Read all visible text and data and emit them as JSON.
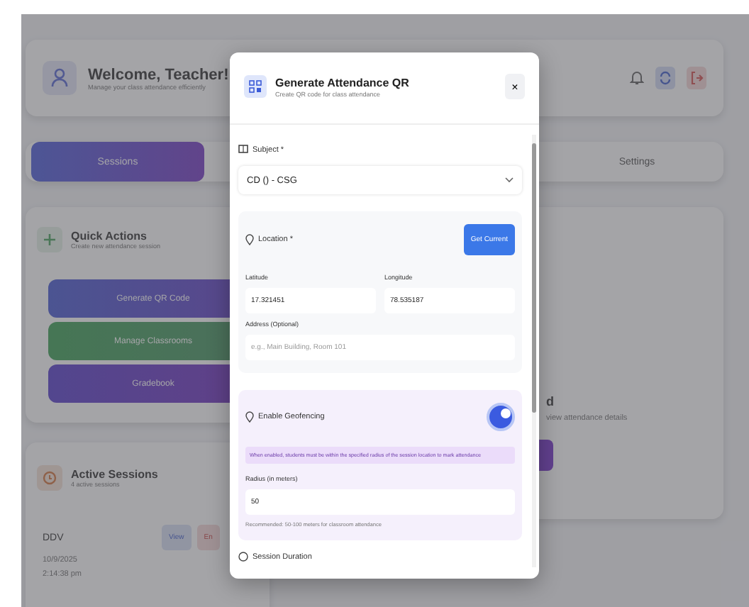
{
  "header": {
    "title": "Welcome, Teacher!",
    "subtitle": "Manage your class attendance efficiently"
  },
  "tabs": [
    {
      "label": "Sessions",
      "selected": true
    },
    {
      "label": "Settings",
      "selected": false
    }
  ],
  "quick_actions": {
    "title": "Quick Actions",
    "subtitle": "Create new attendance session",
    "buttons": [
      {
        "label": "Generate QR Code",
        "kind": "qr"
      },
      {
        "label": "Manage Classrooms",
        "kind": "classroom"
      },
      {
        "label": "Gradebook",
        "kind": "book"
      }
    ]
  },
  "right_panel": {
    "title_fragment": "d",
    "text_fragment": "view attendance details"
  },
  "active_sessions": {
    "title": "Active Sessions",
    "subtitle": "4 active sessions",
    "sessions": [
      {
        "name": "DDV",
        "view": "View",
        "end": "En",
        "date": "10/9/2025",
        "time": "2:14:38 pm"
      }
    ]
  },
  "modal": {
    "title": "Generate Attendance QR",
    "subtitle": "Create QR code for class attendance",
    "close": "×",
    "subject": {
      "label": "Subject *",
      "value": "CD () - CSG"
    },
    "location": {
      "label": "Location *",
      "button": "Get Current",
      "latitude_label": "Latitude",
      "latitude": "17.321451",
      "longitude_label": "Longitude",
      "longitude": "78.535187",
      "address_label": "Address (Optional)",
      "address_placeholder": "e.g., Main Building, Room 101"
    },
    "geofencing": {
      "label": "Enable Geofencing",
      "enabled": true,
      "info": "When enabled, students must be within the specified radius of the session location to mark attendance",
      "radius_label": "Radius (in meters)",
      "radius": "50",
      "hint": "Recommended: 50-100 meters for classroom attendance"
    },
    "next_section": "Session Duration"
  }
}
